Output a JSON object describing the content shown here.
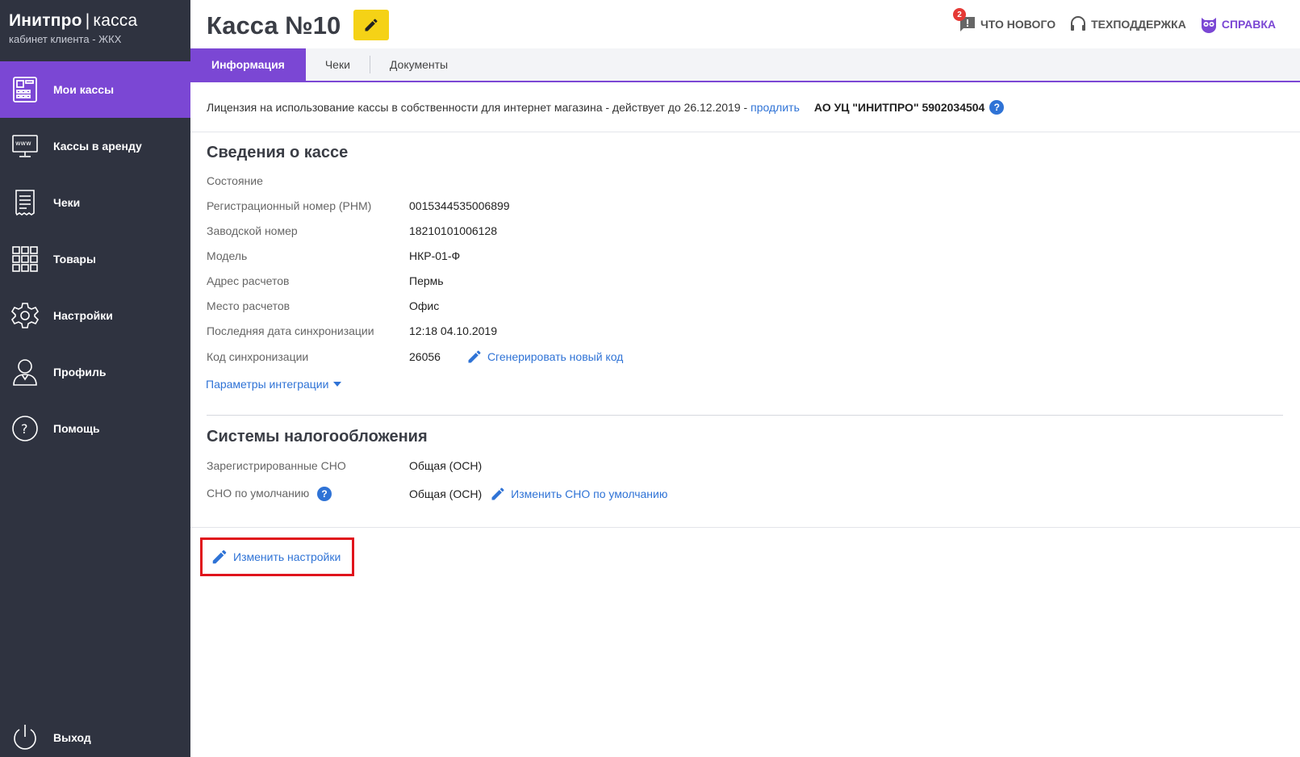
{
  "brand": {
    "name": "Инитпро",
    "separator": "|",
    "product": "касса",
    "subtitle": "кабинет клиента - ЖКХ"
  },
  "sidebar": {
    "items": [
      {
        "label": "Мои кассы",
        "icon": "cash-register-icon",
        "active": true
      },
      {
        "label": "Кассы в аренду",
        "icon": "www-monitor-icon"
      },
      {
        "label": "Чеки",
        "icon": "receipt-icon"
      },
      {
        "label": "Товары",
        "icon": "grid-icon"
      },
      {
        "label": "Настройки",
        "icon": "gear-icon"
      },
      {
        "label": "Профиль",
        "icon": "user-icon"
      },
      {
        "label": "Помощь",
        "icon": "help-circle-icon"
      }
    ],
    "logout": {
      "label": "Выход",
      "icon": "power-icon"
    }
  },
  "header": {
    "title": "Касса №10",
    "whats_new": {
      "label": "ЧТО НОВОГО",
      "badge": "2",
      "icon": "chat-alert-icon"
    },
    "support": {
      "label": "ТЕХПОДДЕРЖКА",
      "icon": "headset-icon"
    },
    "help": {
      "label": "СПРАВКА",
      "icon": "owl-icon"
    }
  },
  "tabs": [
    {
      "label": "Информация",
      "active": true
    },
    {
      "label": "Чеки"
    },
    {
      "label": "Документы"
    }
  ],
  "license": {
    "text": "Лицензия на использование кассы в собственности для интернет магазина - действует до 26.12.2019 -",
    "renew_link": "продлить",
    "org": "АО УЦ \"ИНИТПРО\" 5902034504",
    "help_mark": "?"
  },
  "cash_info": {
    "title": "Сведения о кассе",
    "rows": [
      {
        "key": "Состояние",
        "value": ""
      },
      {
        "key": "Регистрационный номер (РНМ)",
        "value": "0015344535006899"
      },
      {
        "key": "Заводской номер",
        "value": "18210101006128"
      },
      {
        "key": "Модель",
        "value": "НКР-01-Ф"
      },
      {
        "key": "Адрес расчетов",
        "value": "Пермь"
      },
      {
        "key": "Место расчетов",
        "value": "Офис"
      },
      {
        "key": "Последняя дата синхронизации",
        "value": "12:18 04.10.2019"
      },
      {
        "key": "Код синхронизации",
        "value": "26056"
      }
    ],
    "generate_code_link": "Сгенерировать новый код",
    "integration_params_link": "Параметры интеграции"
  },
  "tax": {
    "title": "Системы налогообложения",
    "registered_key": "Зарегистрированные СНО",
    "registered_value": "Общая (ОСН)",
    "default_key": "СНО по умолчанию",
    "default_help_mark": "?",
    "default_value": "Общая (ОСН)",
    "change_default_link": "Изменить СНО по умолчанию"
  },
  "footer": {
    "edit_settings": "Изменить настройки"
  },
  "colors": {
    "sidebar_bg": "#2f3340",
    "accent": "#7b47d4",
    "link": "#2f73d6",
    "highlight": "#f5d216",
    "badge": "#e53935",
    "focus_box": "#e0141c"
  }
}
